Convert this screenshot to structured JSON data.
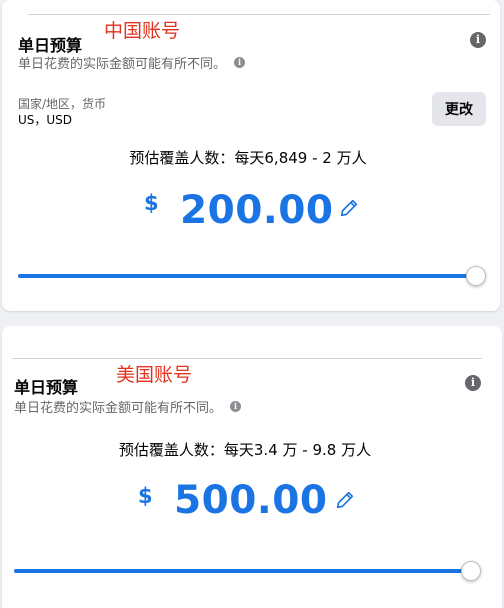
{
  "cards": [
    {
      "overlay_label": "中国账号",
      "heading": "单日预算",
      "subtext": "单日花费的实际金额可能有所不同。",
      "currency_label": "国家/地区，货币",
      "currency_value": "US，USD",
      "change_button": "更改",
      "reach_text": "预估覆盖人数：每天6,849 - 2 万人",
      "currency_symbol": "$",
      "amount": "200.00",
      "slider_level": 1.0
    },
    {
      "overlay_label": "美国账号",
      "heading": "单日预算",
      "subtext": "单日花费的实际金额可能有所不同。",
      "reach_text": "预估覆盖人数：每天3.4 万 - 9.8 万人",
      "currency_symbol": "$",
      "amount": "500.00",
      "slider_level": 1.0
    }
  ],
  "icons": {
    "info": "info-icon",
    "edit": "pencil-icon"
  },
  "colors": {
    "accent": "#1b74e4",
    "overlay_text": "#e3331f",
    "secondary_text": "#65676b",
    "button_bg": "#e4e6eb"
  }
}
